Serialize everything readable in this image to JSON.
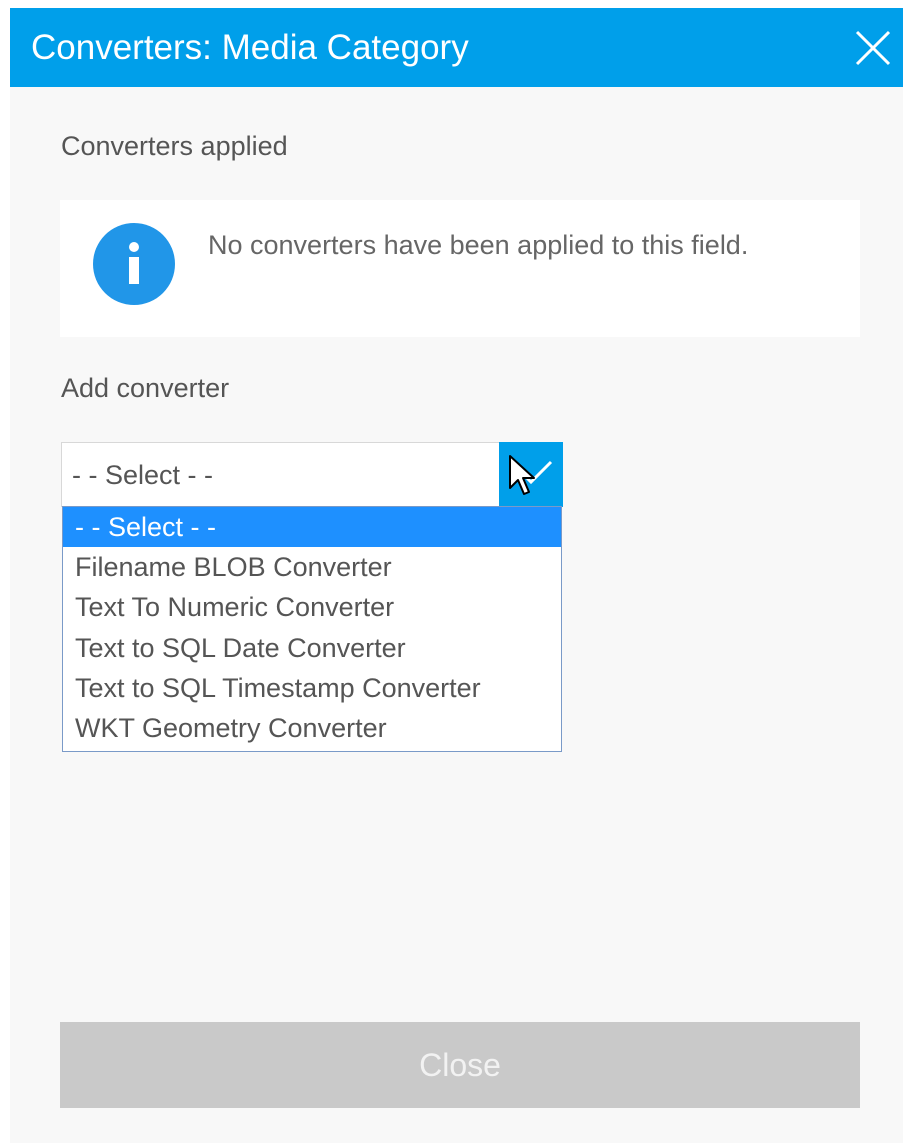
{
  "dialog": {
    "title": "Converters: Media Category",
    "close_icon": "close-icon",
    "accent_color": "#009fea"
  },
  "applied": {
    "heading": "Converters applied",
    "info_icon": "info-icon",
    "message": "No converters have been applied to this field."
  },
  "add": {
    "heading": "Add converter",
    "select": {
      "value": "- - Select - -",
      "arrow_icon": "chevron-down-icon"
    },
    "options": [
      {
        "label": "- - Select - -",
        "selected": true
      },
      {
        "label": "Filename BLOB Converter",
        "selected": false
      },
      {
        "label": "Text To Numeric Converter",
        "selected": false
      },
      {
        "label": "Text to SQL Date Converter",
        "selected": false
      },
      {
        "label": "Text to SQL Timestamp Converter",
        "selected": false
      },
      {
        "label": "WKT Geometry Converter",
        "selected": false
      }
    ],
    "highlight_color": "#1e90ff"
  },
  "footer": {
    "close_label": "Close"
  }
}
